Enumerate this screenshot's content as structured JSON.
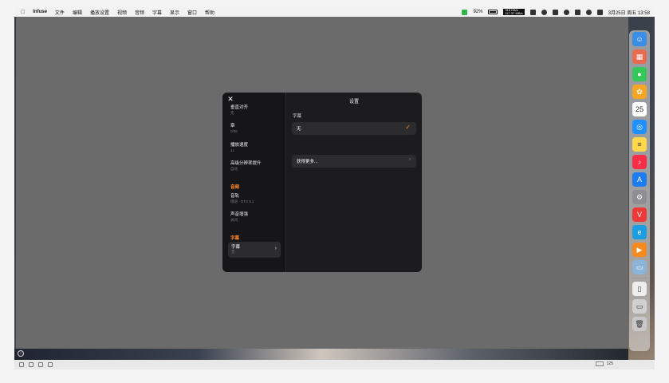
{
  "menubar": {
    "app_name": "Infuse",
    "items": [
      "文件",
      "编辑",
      "播放设置",
      "视频",
      "音频",
      "字幕",
      "显示",
      "窗口",
      "帮助"
    ],
    "battery": "92%",
    "net_up": "318 KB/s",
    "net_down": "117.37 MB/s",
    "clock": "3月25日 周五  13:58"
  },
  "modal": {
    "title": "设置",
    "left_items": [
      {
        "label": "垂直对齐",
        "sub": "无"
      },
      {
        "label": "章",
        "sub": "0/35"
      },
      {
        "label": "播放速度",
        "sub": "1x"
      },
      {
        "label": "高级分辨率提升",
        "sub": "自动"
      }
    ],
    "audio_section": "音频",
    "audio_items": [
      {
        "label": "音轨",
        "sub": "俄语 · DTS 5.1"
      },
      {
        "label": "声音增强",
        "sub": "关闭"
      }
    ],
    "subtitle_section": "字幕",
    "selected_item": {
      "label": "字幕",
      "sub": "无"
    },
    "right_section_label": "字幕",
    "option_none": "无",
    "option_more": "获得更多..."
  },
  "dock": {
    "apps": [
      {
        "name": "finder-icon",
        "color": "#3a8ee6",
        "glyph": "☺"
      },
      {
        "name": "launchpad-icon",
        "color": "#e96b4f",
        "glyph": "▦"
      },
      {
        "name": "messages-icon",
        "color": "#34c759",
        "glyph": "●"
      },
      {
        "name": "photos-icon",
        "color": "#f5a623",
        "glyph": "✿"
      },
      {
        "name": "calendar-icon",
        "color": "#ffffff",
        "glyph": "25"
      },
      {
        "name": "safari-icon",
        "color": "#1e90ff",
        "glyph": "◎"
      },
      {
        "name": "notes-icon",
        "color": "#ffd84a",
        "glyph": "≡"
      },
      {
        "name": "music-icon",
        "color": "#fa2d48",
        "glyph": "♪"
      },
      {
        "name": "app-store-icon",
        "color": "#1c7cf0",
        "glyph": "A"
      },
      {
        "name": "system-preferences-icon",
        "color": "#8e8e93",
        "glyph": "⚙"
      },
      {
        "name": "vivaldi-icon",
        "color": "#ef3939",
        "glyph": "V"
      },
      {
        "name": "edge-icon",
        "color": "#1b9de2",
        "glyph": "e"
      },
      {
        "name": "infuse-icon",
        "color": "#f58b1f",
        "glyph": "▶"
      },
      {
        "name": "preview-icon",
        "color": "#8ab4d8",
        "glyph": "▭"
      },
      {
        "name": "document-icon",
        "color": "#eeeeee",
        "glyph": "▯"
      },
      {
        "name": "downloads-icon",
        "color": "#d0d0d0",
        "glyph": "▭"
      },
      {
        "name": "trash-icon",
        "color": "#c8c8c8",
        "glyph": "🗑"
      }
    ]
  },
  "status": {
    "zoom": "125"
  }
}
